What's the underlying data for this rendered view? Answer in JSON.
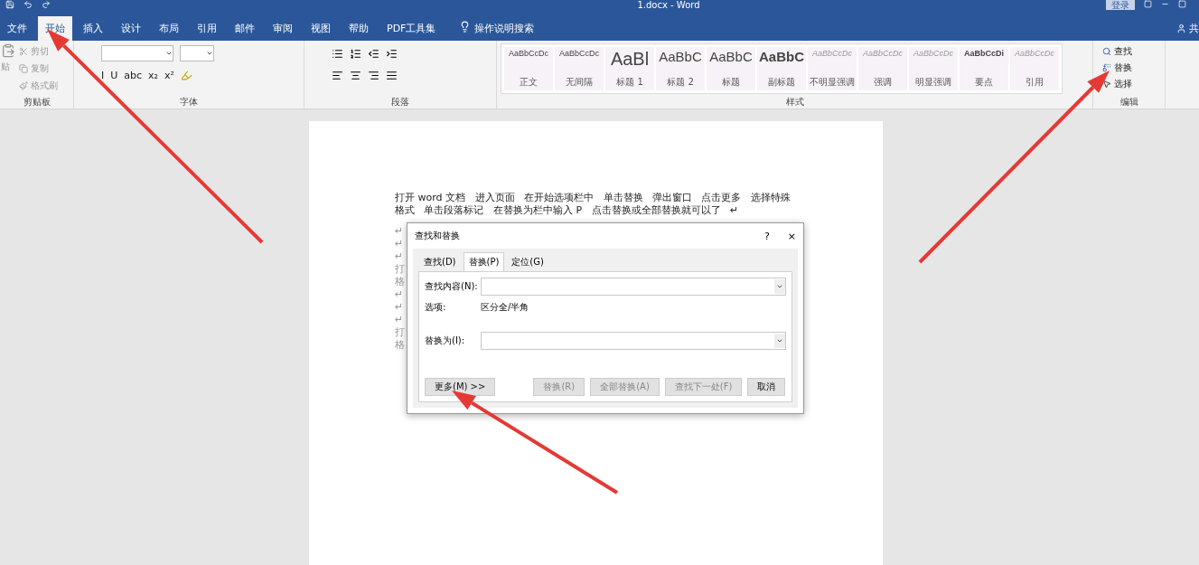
{
  "window": {
    "title": "1.docx - Word",
    "login": "登录",
    "share": "共"
  },
  "tabs": [
    {
      "label": "文件",
      "selected": false
    },
    {
      "label": "开始",
      "selected": true
    },
    {
      "label": "插入",
      "selected": false
    },
    {
      "label": "设计",
      "selected": false
    },
    {
      "label": "布局",
      "selected": false
    },
    {
      "label": "引用",
      "selected": false
    },
    {
      "label": "邮件",
      "selected": false
    },
    {
      "label": "审阅",
      "selected": false
    },
    {
      "label": "视图",
      "selected": false
    },
    {
      "label": "帮助",
      "selected": false
    },
    {
      "label": "PDF工具集",
      "selected": false
    }
  ],
  "tell_me": "操作说明搜索",
  "clipboard": {
    "paste": "贴",
    "cut": "剪切",
    "copy": "复制",
    "format_painter": "格式刷",
    "label": "剪贴板"
  },
  "font": {
    "row2": [
      "I",
      "U",
      "abc",
      "x₂",
      "x²"
    ],
    "label": "字体"
  },
  "paragraph": {
    "label": "段落"
  },
  "styles": {
    "label": "样式",
    "items": [
      {
        "preview": "AaBbCcDc",
        "name": "正文",
        "kind": "small"
      },
      {
        "preview": "AaBbCcDc",
        "name": "无间隔",
        "kind": "small"
      },
      {
        "preview": "AaBl",
        "name": "标题 1",
        "kind": "huge"
      },
      {
        "preview": "AaBbC",
        "name": "标题 2",
        "kind": "large"
      },
      {
        "preview": "AaBbC",
        "name": "标题",
        "kind": "large"
      },
      {
        "preview": "AaBbC",
        "name": "副标题",
        "kind": "boldlarge"
      },
      {
        "preview": "AaBbCcDc",
        "name": "不明显强调",
        "kind": "italic"
      },
      {
        "preview": "AaBbCcDc",
        "name": "强调",
        "kind": "italic"
      },
      {
        "preview": "AaBbCcDc",
        "name": "明显强调",
        "kind": "italic"
      },
      {
        "preview": "AaBbCcDi",
        "name": "要点",
        "kind": "bold"
      },
      {
        "preview": "AaBbCcDc",
        "name": "引用",
        "kind": "italic"
      }
    ]
  },
  "editing": {
    "find": "查找",
    "replace": "替换",
    "select": "选择",
    "label": "编辑"
  },
  "document": {
    "lines": [
      "打开 word 文档   进入页面   在开始选项栏中   单击替换   弹出窗口   点击更多   选择特殊",
      "格式   单击段落标记   在替换为栏中输入 P   点击替换或全部替换就可以了   ↵"
    ],
    "margin_lines": [
      "↵",
      "↵",
      "↵",
      "打",
      "格",
      "↵",
      "↵",
      "↵",
      "打",
      "格"
    ]
  },
  "dialog": {
    "title": "查找和替换",
    "help": "?",
    "close": "×",
    "tabs": [
      {
        "label": "查找(D)",
        "selected": false
      },
      {
        "label": "替换(P)",
        "selected": true
      },
      {
        "label": "定位(G)",
        "selected": false
      }
    ],
    "find_label": "查找内容(N):",
    "options_label": "选项:",
    "options_value": "区分全/半角",
    "replace_label": "替换为(I):",
    "buttons": [
      {
        "label": "更多(M) >>",
        "disabled": false,
        "kind": "left"
      },
      {
        "label": "替换(R)",
        "disabled": true,
        "kind": "right"
      },
      {
        "label": "全部替换(A)",
        "disabled": true,
        "kind": "right"
      },
      {
        "label": "查找下一处(F)",
        "disabled": true,
        "kind": "right"
      },
      {
        "label": "取消",
        "disabled": false,
        "kind": "right"
      }
    ]
  }
}
